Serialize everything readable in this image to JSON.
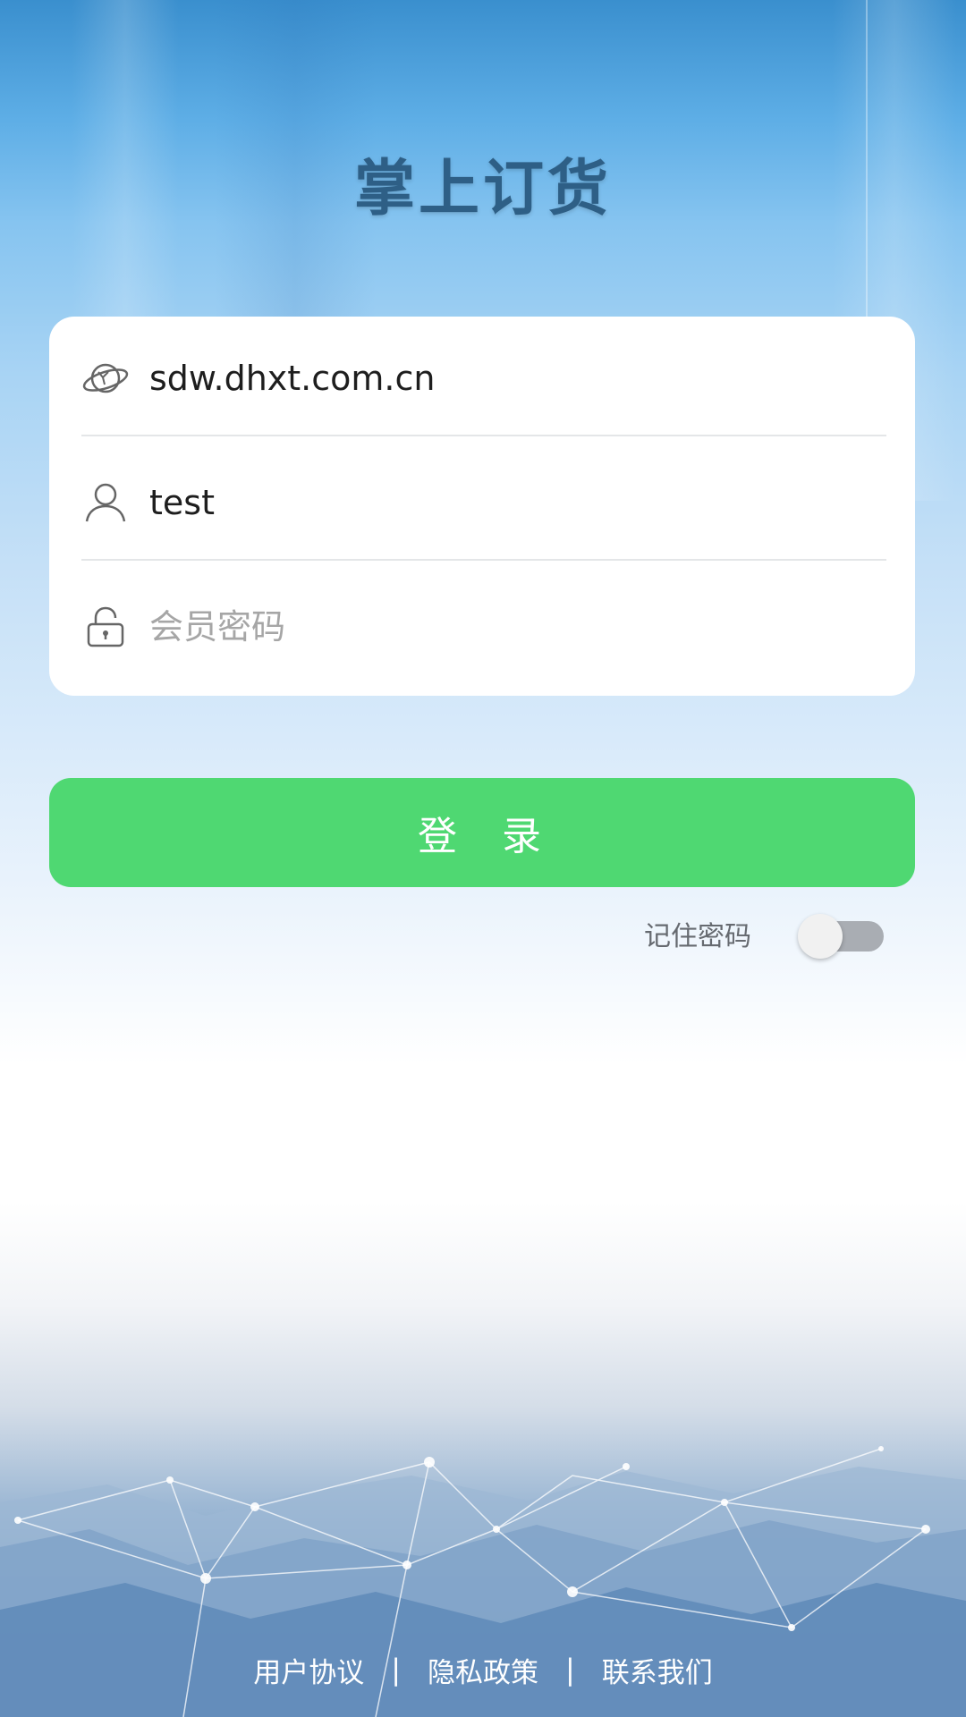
{
  "app": {
    "title": "掌上订货"
  },
  "form": {
    "server": {
      "icon": "planet-icon",
      "value": "sdw.dhxt.com.cn"
    },
    "username": {
      "icon": "user-icon",
      "value": "test"
    },
    "password": {
      "icon": "lock-icon",
      "value": "",
      "placeholder": "会员密码"
    }
  },
  "login_button": {
    "label": "登 录",
    "color": "#4fd872"
  },
  "remember": {
    "label": "记住密码",
    "checked": false
  },
  "footer": {
    "links": [
      "用户协议",
      "隐私政策",
      "联系我们"
    ],
    "separator": "|"
  },
  "colors": {
    "title": "#2e5f86",
    "accent": "#4fd872"
  }
}
